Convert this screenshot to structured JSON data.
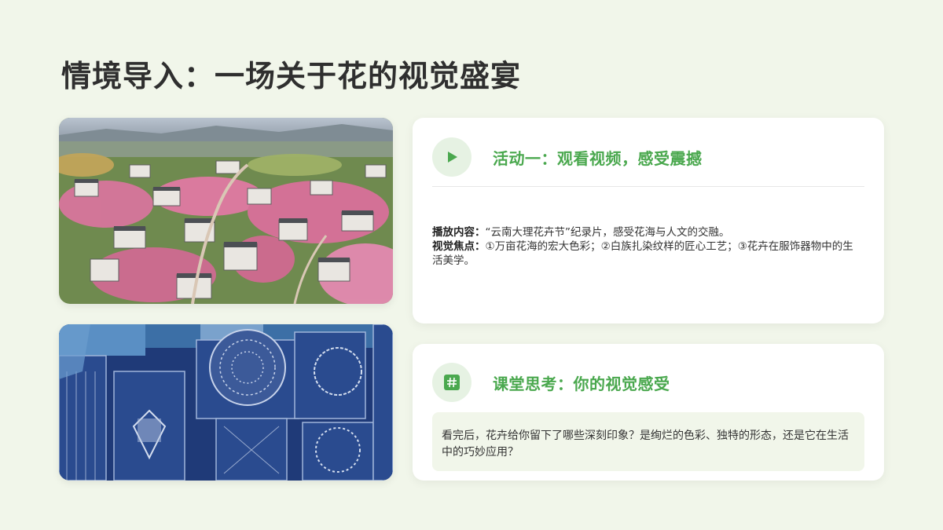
{
  "page": {
    "title": "情境导入：一场关于花的视觉盛宴"
  },
  "images": [
    {
      "name": "dali-flower-village-photo",
      "alt": "aerial view of houses among pink blossoms"
    },
    {
      "name": "bai-tie-dye-fabric-photo",
      "alt": "blue-and-white tie-dye fabrics"
    }
  ],
  "activity": {
    "icon": "play-icon",
    "title": "活动一：观看视频，感受震撼",
    "content_label": "播放内容：",
    "content_text": "“云南大理花卉节”纪录片，感受花海与人文的交融。",
    "focus_label": "视觉焦点：",
    "focus_text": "①万亩花海的宏大色彩；②白族扎染纹样的匠心工艺；③花卉在服饰器物中的生活美学。"
  },
  "reflection": {
    "icon": "hash-icon",
    "title": "课堂思考：你的视觉感受",
    "question": "看完后，花卉给你留下了哪些深刻印象？是绚烂的色彩、独特的形态，还是它在生活中的巧妙应用？"
  },
  "colors": {
    "background": "#f1f6ea",
    "accent_green": "#4aa84e",
    "icon_circle": "#e6f2e3",
    "card": "#ffffff"
  }
}
